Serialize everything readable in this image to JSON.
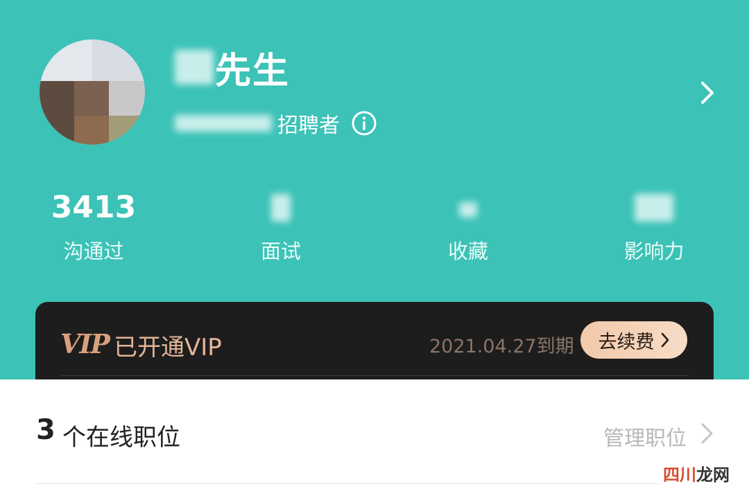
{
  "profile": {
    "name_suffix": "先生",
    "role": "招聘者"
  },
  "stats": [
    {
      "value": "3413",
      "label": "沟通过"
    },
    {
      "value": "",
      "label": "面试"
    },
    {
      "value": "",
      "label": "收藏"
    },
    {
      "value": "",
      "label": "影响力"
    }
  ],
  "vip": {
    "badge": "VIP",
    "status": "已开通VIP",
    "expire": "2021.04.27到期",
    "renew_label": "去续费"
  },
  "jobs": {
    "count": "3",
    "label": "个在线职位",
    "manage_label": "管理职位"
  },
  "watermark": {
    "part1": "四川",
    "part2": "龙网"
  },
  "colors": {
    "header_bg": "#3cc2b7",
    "vip_card_bg": "#1e1d1d",
    "vip_gold": "#e3b597"
  }
}
